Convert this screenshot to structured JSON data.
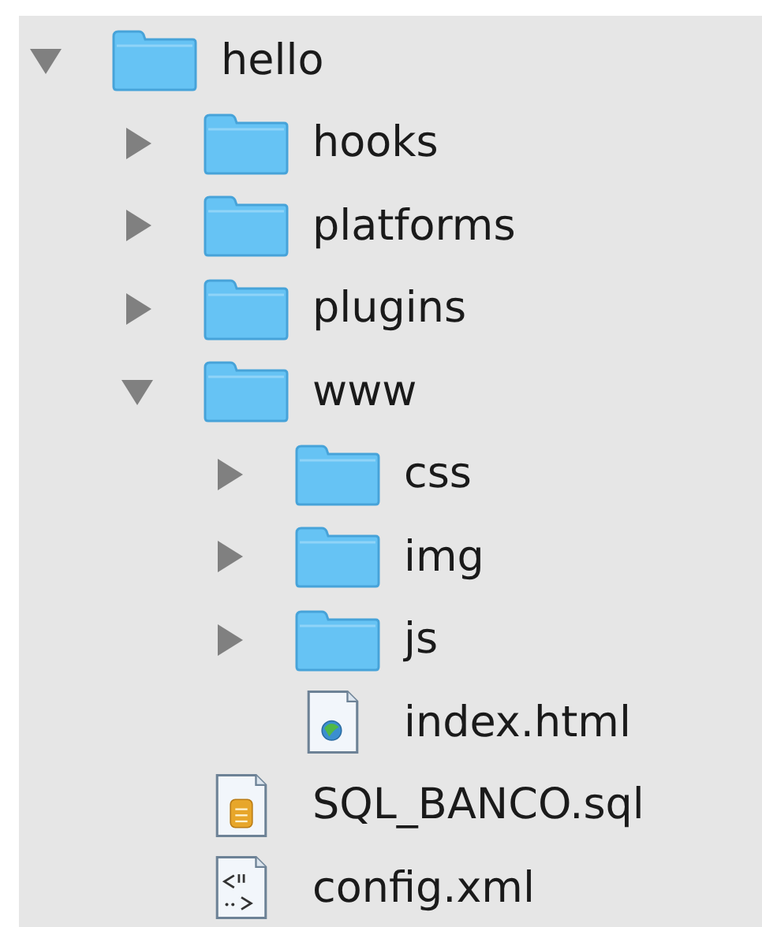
{
  "tree": [
    {
      "label": "hello",
      "kind": "folder",
      "expanded": true,
      "children": [
        {
          "label": "hooks",
          "kind": "folder",
          "expanded": false
        },
        {
          "label": "platforms",
          "kind": "folder",
          "expanded": false
        },
        {
          "label": "plugins",
          "kind": "folder",
          "expanded": false
        },
        {
          "label": "www",
          "kind": "folder",
          "expanded": true,
          "children": [
            {
              "label": "css",
              "kind": "folder",
              "expanded": false
            },
            {
              "label": "img",
              "kind": "folder",
              "expanded": false
            },
            {
              "label": "js",
              "kind": "folder",
              "expanded": false
            },
            {
              "label": "index.html",
              "kind": "html"
            }
          ]
        },
        {
          "label": "SQL_BANCO.sql",
          "kind": "sql"
        },
        {
          "label": "config.xml",
          "kind": "xml"
        }
      ]
    }
  ]
}
